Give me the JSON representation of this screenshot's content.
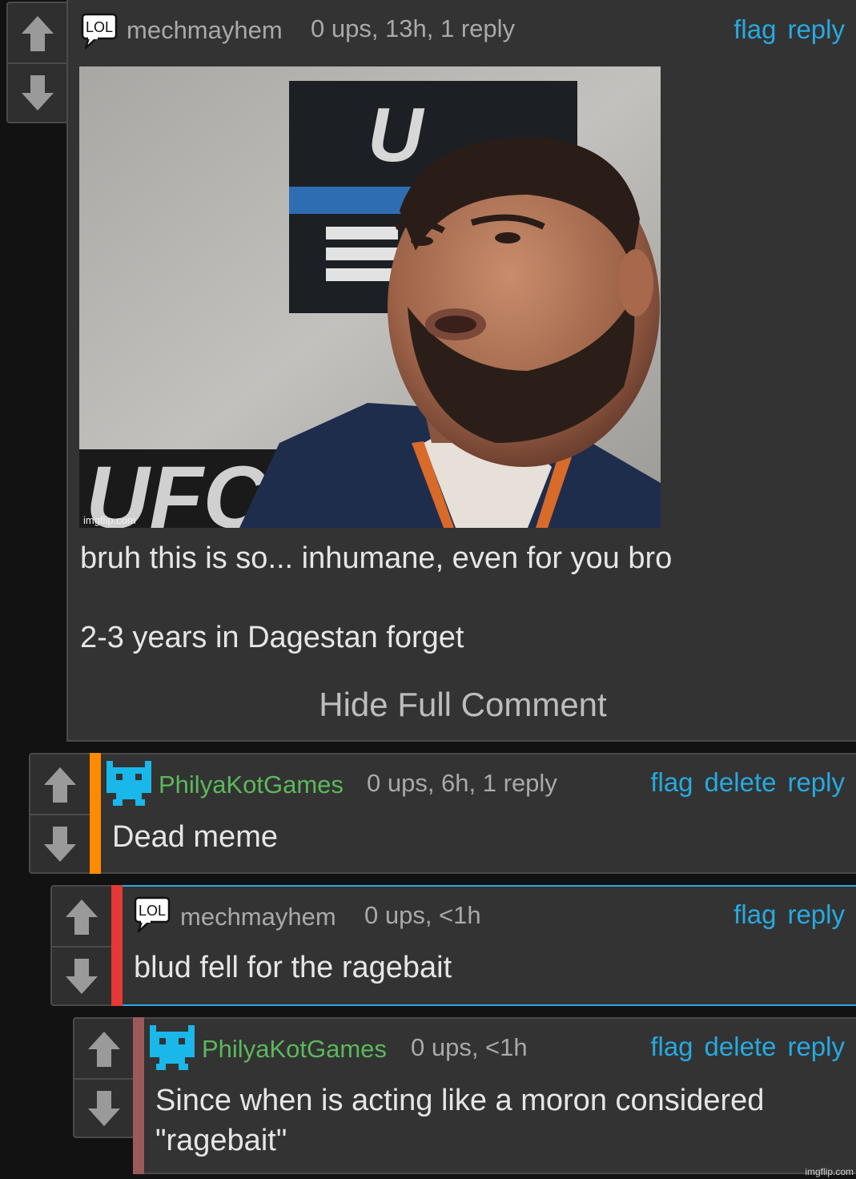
{
  "colors": {
    "link": "#27a9e1",
    "green_user": "#5cb85c",
    "stripe_orange": "#ff8c00",
    "stripe_red": "#e53935",
    "stripe_brown": "#9b5a5a",
    "cat_icon": "#19b7ea"
  },
  "comments": [
    {
      "username": "mechmayhem",
      "meta": "0 ups, 13h, 1 reply",
      "actions": [
        "flag",
        "reply"
      ],
      "avatar": "lol-bubble-icon",
      "image_watermark": "imgflip.com",
      "text_line1": "bruh this is so... inhumane, even for you bro",
      "text_line2": "2-3 years in Dagestan forget",
      "toggle": "Hide Full Comment"
    },
    {
      "username": "PhilyaKotGames",
      "meta": "0 ups, 6h, 1 reply",
      "actions": [
        "flag",
        "delete",
        "reply"
      ],
      "avatar": "pixel-cat-icon",
      "text": "Dead meme"
    },
    {
      "username": "mechmayhem",
      "meta": "0 ups, <1h",
      "actions": [
        "flag",
        "reply"
      ],
      "avatar": "lol-bubble-icon",
      "text": "blud fell for the ragebait"
    },
    {
      "username": "PhilyaKotGames",
      "meta": "0 ups, <1h",
      "actions": [
        "flag",
        "delete",
        "reply"
      ],
      "avatar": "pixel-cat-icon",
      "text_line1": "Since when is acting like a moron considered",
      "text_line2": "\"ragebait\""
    }
  ],
  "footer_watermark": "imgflip.com",
  "lol_badge": "LOL"
}
